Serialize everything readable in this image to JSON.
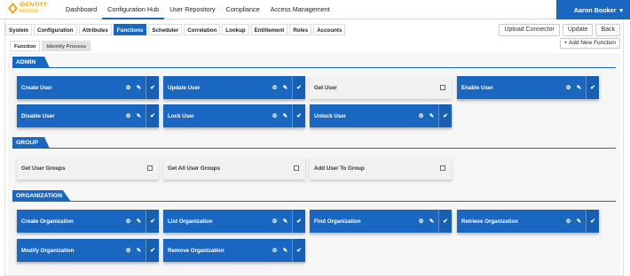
{
  "app": {
    "logo_line1": "IDENTITY",
    "logo_line2": "BRIDGE"
  },
  "colors": {
    "primary": "#1a67c1",
    "logo": "#e8a316"
  },
  "topnav": [
    {
      "label": "Dashboard"
    },
    {
      "label": "Configuration Hub"
    },
    {
      "label": "User Repository"
    },
    {
      "label": "Compliance"
    },
    {
      "label": "Access Management"
    }
  ],
  "user": {
    "name": "Aaron Booker",
    "caret": "▾"
  },
  "tabs": [
    {
      "label": "System"
    },
    {
      "label": "Configuration"
    },
    {
      "label": "Attributes"
    },
    {
      "label": "Functions"
    },
    {
      "label": "Scheduler"
    },
    {
      "label": "Correlation"
    },
    {
      "label": "Lookup"
    },
    {
      "label": "Entitlement"
    },
    {
      "label": "Roles"
    },
    {
      "label": "Accounts"
    }
  ],
  "actions": {
    "upload": "Upload Connector",
    "update": "Update",
    "back": "Back"
  },
  "subtabs": [
    {
      "label": "Function"
    },
    {
      "label": "Identity Process"
    }
  ],
  "add_function": "+ Add New Function",
  "icons": {
    "gear": "⚙",
    "edit": "✎",
    "check": "✔"
  },
  "sections": [
    {
      "title": "ADMIN",
      "cards": [
        {
          "name": "Create User",
          "enabled": true
        },
        {
          "name": "Update User",
          "enabled": true
        },
        {
          "name": "Get User",
          "enabled": false
        },
        {
          "name": "Enable User",
          "enabled": true
        },
        {
          "name": "Disable User",
          "enabled": true
        },
        {
          "name": "Lock User",
          "enabled": true
        },
        {
          "name": "Unlock User",
          "enabled": true
        }
      ]
    },
    {
      "title": "GROUP",
      "cards": [
        {
          "name": "Get User Groups",
          "enabled": false
        },
        {
          "name": "Get All User Groups",
          "enabled": false
        },
        {
          "name": "Add User To Group",
          "enabled": false
        }
      ]
    },
    {
      "title": "ORGANIZATION",
      "cards": [
        {
          "name": "Create Organization",
          "enabled": true
        },
        {
          "name": "List Organization",
          "enabled": true
        },
        {
          "name": "Find Organization",
          "enabled": true
        },
        {
          "name": "Retrieve Organization",
          "enabled": true
        },
        {
          "name": "Modify Organization",
          "enabled": true
        },
        {
          "name": "Remove Organization",
          "enabled": true
        }
      ]
    }
  ]
}
